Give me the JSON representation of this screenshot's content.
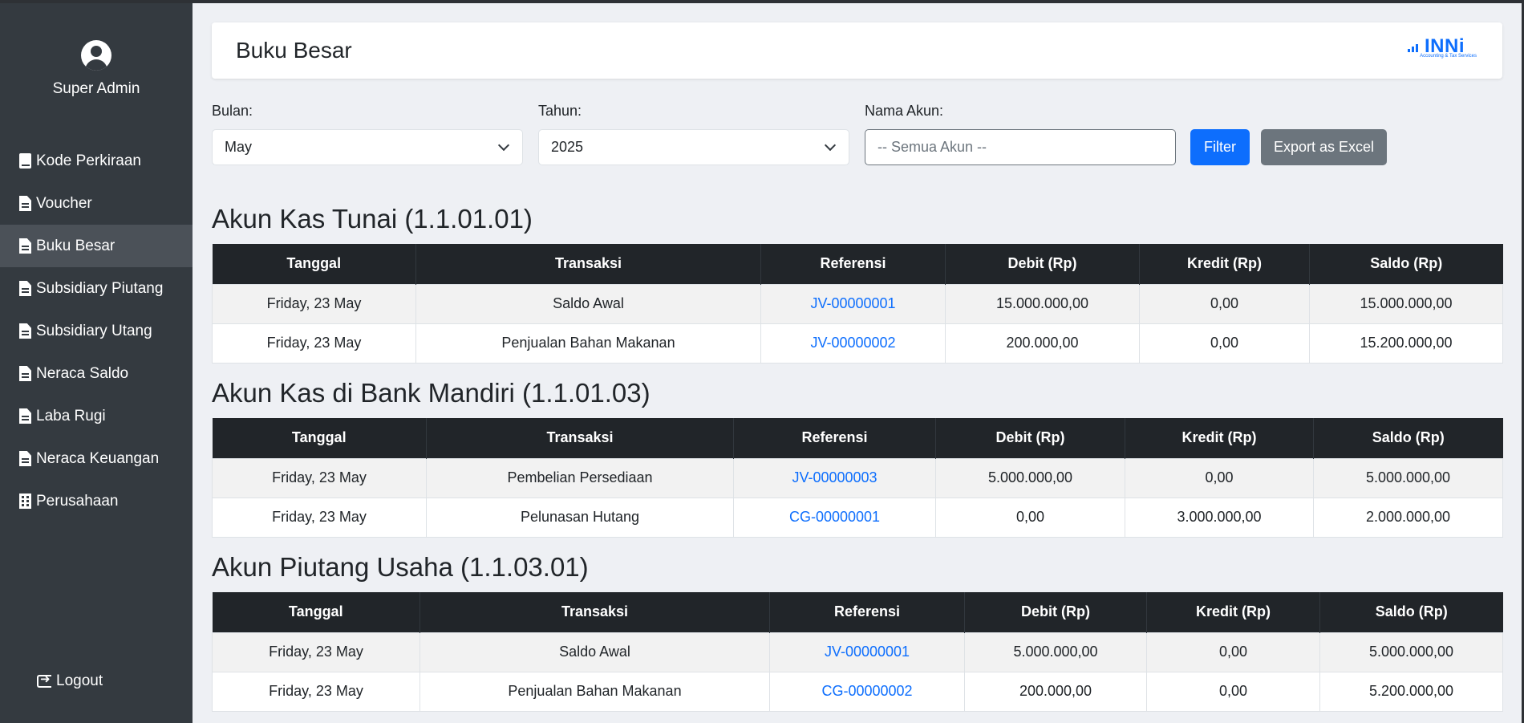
{
  "sidebar": {
    "user_name": "Super Admin",
    "items": [
      {
        "label": "Kode Perkiraan",
        "icon": "book-icon"
      },
      {
        "label": "Voucher",
        "icon": "file-invoice-icon"
      },
      {
        "label": "Buku Besar",
        "icon": "file-icon",
        "active": true
      },
      {
        "label": "Subsidiary Piutang",
        "icon": "file-icon"
      },
      {
        "label": "Subsidiary Utang",
        "icon": "file-icon"
      },
      {
        "label": "Neraca Saldo",
        "icon": "file-icon"
      },
      {
        "label": "Laba Rugi",
        "icon": "file-icon"
      },
      {
        "label": "Neraca Keuangan",
        "icon": "file-icon"
      },
      {
        "label": "Perusahaan",
        "icon": "building-icon"
      }
    ],
    "logout_label": "Logout"
  },
  "header": {
    "title": "Buku Besar",
    "logo_text": "INNi",
    "logo_subtext": "Accounting & Tax Services"
  },
  "filters": {
    "bulan_label": "Bulan:",
    "bulan_value": "May",
    "tahun_label": "Tahun:",
    "tahun_value": "2025",
    "akun_label": "Nama Akun:",
    "akun_placeholder": "-- Semua Akun --",
    "filter_button": "Filter",
    "export_button": "Export as Excel"
  },
  "columns": [
    "Tanggal",
    "Transaksi",
    "Referensi",
    "Debit (Rp)",
    "Kredit (Rp)",
    "Saldo (Rp)"
  ],
  "accounts": [
    {
      "title": "Akun Kas Tunai (1.1.01.01)",
      "rows": [
        [
          "Friday, 23 May",
          "Saldo Awal",
          "JV-00000001",
          "15.000.000,00",
          "0,00",
          "15.000.000,00"
        ],
        [
          "Friday, 23 May",
          "Penjualan Bahan Makanan",
          "JV-00000002",
          "200.000,00",
          "0,00",
          "15.200.000,00"
        ]
      ]
    },
    {
      "title": "Akun Kas di Bank Mandiri (1.1.01.03)",
      "rows": [
        [
          "Friday, 23 May",
          "Pembelian Persediaan",
          "JV-00000003",
          "5.000.000,00",
          "0,00",
          "5.000.000,00"
        ],
        [
          "Friday, 23 May",
          "Pelunasan Hutang",
          "CG-00000001",
          "0,00",
          "3.000.000,00",
          "2.000.000,00"
        ]
      ]
    },
    {
      "title": "Akun Piutang Usaha (1.1.03.01)",
      "rows": [
        [
          "Friday, 23 May",
          "Saldo Awal",
          "JV-00000001",
          "5.000.000,00",
          "0,00",
          "5.000.000,00"
        ],
        [
          "Friday, 23 May",
          "Penjualan Bahan Makanan",
          "CG-00000002",
          "200.000,00",
          "0,00",
          "5.200.000,00"
        ]
      ]
    }
  ]
}
